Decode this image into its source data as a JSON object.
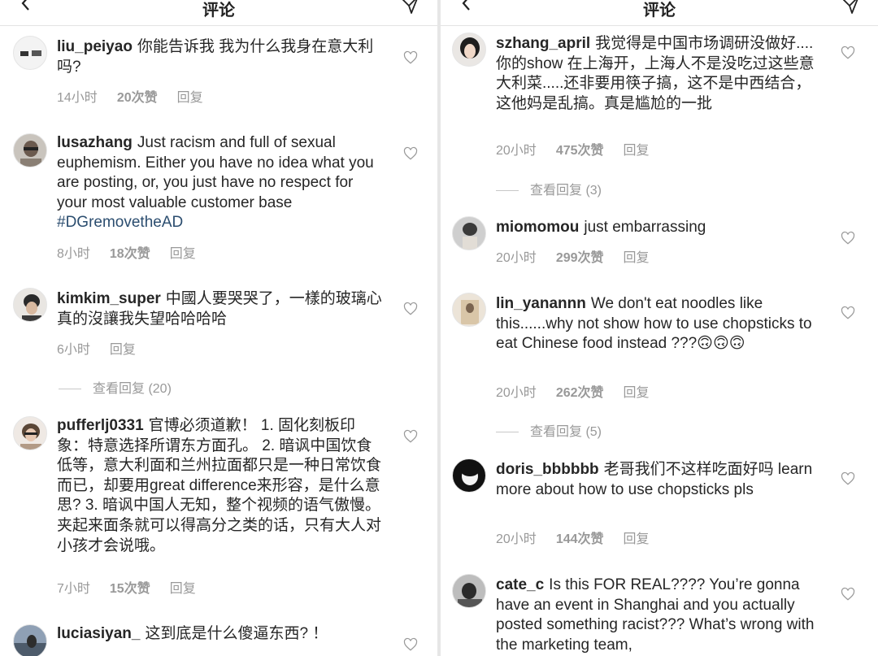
{
  "left_panel": {
    "header": {
      "title": "评论"
    },
    "comments": [
      {
        "user": "liu_peiyao",
        "text": "你能告诉我 我为什么我身在意大利吗?",
        "time": "14小时",
        "likes": "20次赞",
        "reply": "回复"
      },
      {
        "user": "lusazhang",
        "text": "Just racism and full of sexual euphemism. Either you have no idea what you are posting, or, you just have no respect for your most valuable customer base ",
        "tag": "#DGremovetheAD",
        "time": "8小时",
        "likes": "18次赞",
        "reply": "回复"
      },
      {
        "user": "kimkim_super",
        "text": "中國人要哭哭了，一樣的玻璃心真的沒讓我失望哈哈哈哈",
        "time": "6小时",
        "reply": "回复",
        "view_replies": "查看回复 (20)"
      },
      {
        "user": "pufferlj0331",
        "text": "官博必须道歉！ 1. 固化刻板印象：特意选择所谓东方面孔。 2. 暗讽中国饮食低等，意大利面和兰州拉面都只是一种日常饮食而已，却要用great difference来形容，是什么意思? 3. 暗讽中国人无知，整个视频的语气傲慢。夹起来面条就可以得高分之类的话，只有大人对小孩才会说哦。",
        "time": "7小时",
        "likes": "15次赞",
        "reply": "回复"
      },
      {
        "user": "luciasiyan_",
        "text": "这到底是什么傻逼东西? ！"
      }
    ]
  },
  "right_panel": {
    "header": {
      "title": "评论"
    },
    "comments": [
      {
        "user": "szhang_april",
        "text": "我觉得是中国市场调研没做好....你的show 在上海开，上海人不是没吃过这些意大利菜.....还非要用筷子搞，这不是中西结合，这他妈是乱搞。真是尴尬的一批",
        "time": "20小时",
        "likes": "475次赞",
        "reply": "回复",
        "view_replies": "查看回复 (3)"
      },
      {
        "user": "miomomou",
        "text": "just embarrassing",
        "time": "20小时",
        "likes": "299次赞",
        "reply": "回复"
      },
      {
        "user": "lin_yanannn",
        "text": "We don't eat noodles like this......why not show how to use chopsticks to eat Chinese food instead ???🙃🙃🙃",
        "time": "20小时",
        "likes": "262次赞",
        "reply": "回复",
        "view_replies": "查看回复 (5)"
      },
      {
        "user": "doris_bbbbbb",
        "text": "老哥我们不这样吃面好吗 learn more about how to use chopsticks pls",
        "time": "20小时",
        "likes": "144次赞",
        "reply": "回复"
      },
      {
        "user": "cate_c",
        "text": "Is this FOR REAL???? You’re gonna have an event in Shanghai and you actually posted something racist??? What’s wrong with the marketing team,"
      }
    ]
  },
  "colors": {
    "text": "#262626",
    "meta": "#999999",
    "hashtag": "#2b4d6f",
    "divider": "#e4e4e4"
  }
}
